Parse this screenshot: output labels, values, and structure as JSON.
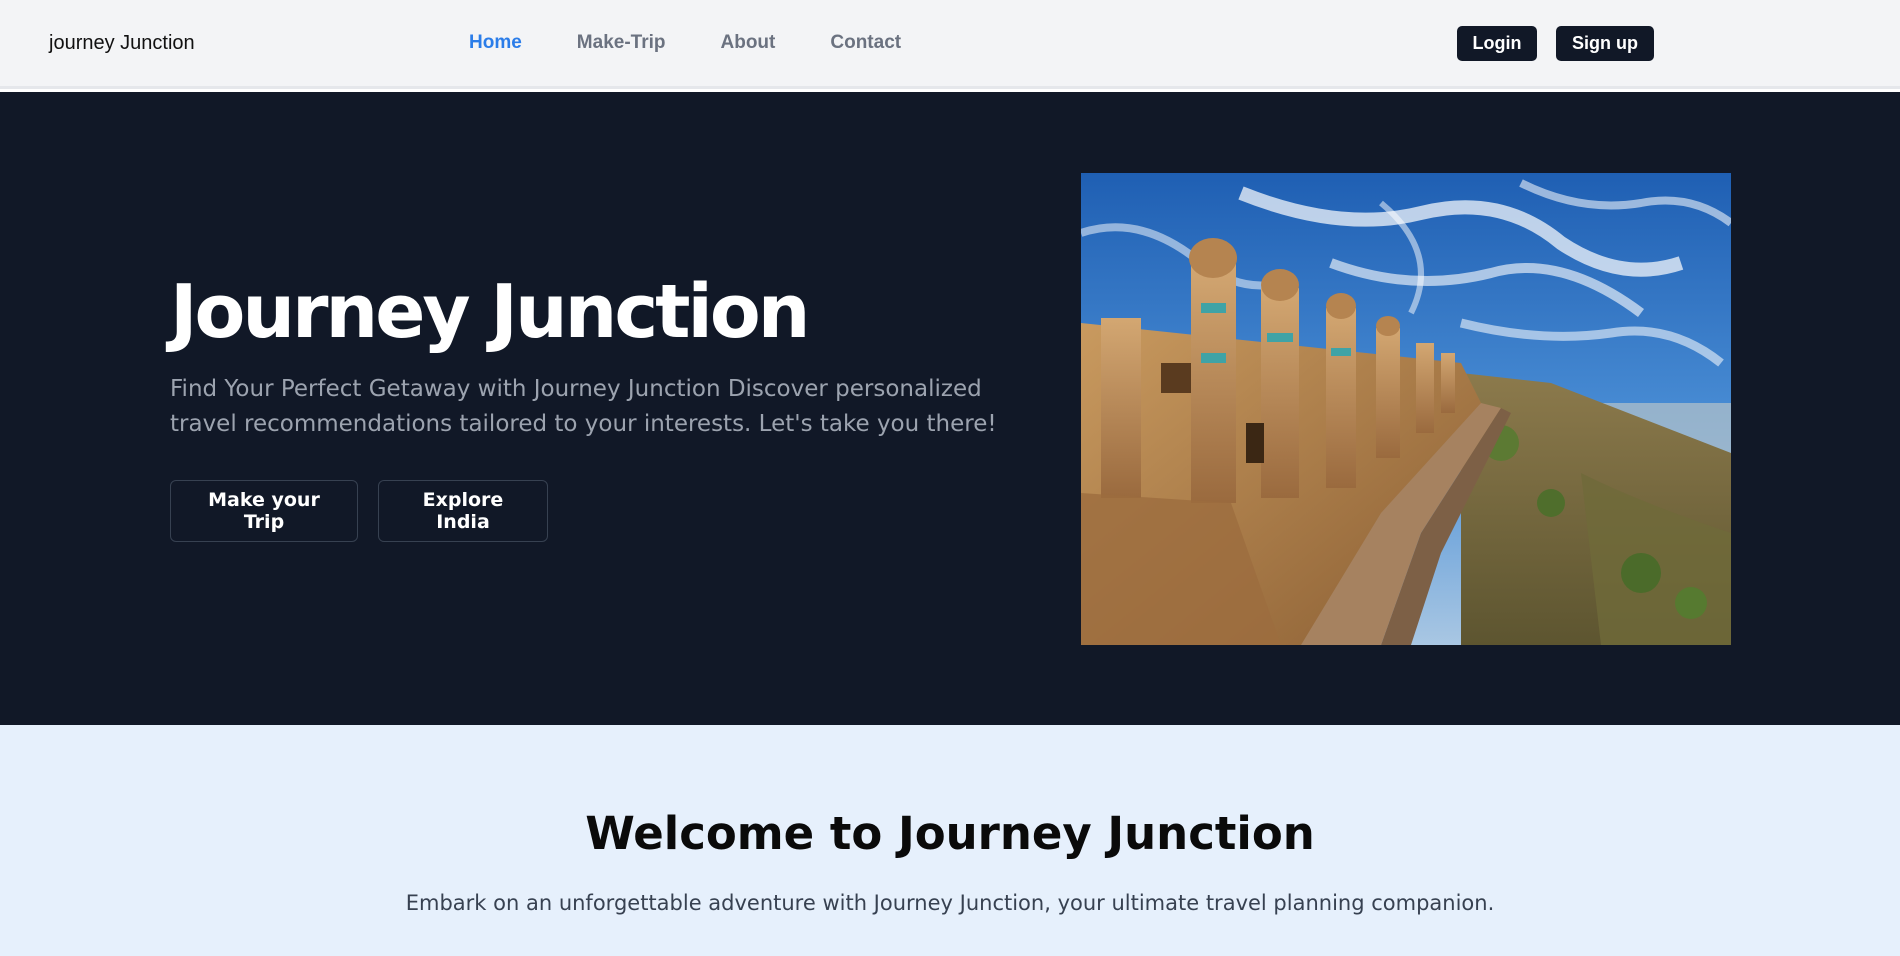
{
  "navbar": {
    "brand": "journey Junction",
    "links": [
      {
        "label": "Home",
        "active": true
      },
      {
        "label": "Make-Trip",
        "active": false
      },
      {
        "label": "About",
        "active": false
      },
      {
        "label": "Contact",
        "active": false
      }
    ],
    "login_label": "Login",
    "signup_label": "Sign up"
  },
  "hero": {
    "title": "Journey Junction",
    "subtitle": "Find Your Perfect Getaway with Journey Junction Discover personalized travel recommendations tailored to your interests. Let's take you there!",
    "make_trip_label": "Make your Trip",
    "explore_label": "Explore India",
    "image_icon": "fort-photo"
  },
  "welcome": {
    "title": "Welcome to Journey Junction",
    "text": "Embark on an unforgettable adventure with Journey Junction, your ultimate travel planning companion."
  },
  "colors": {
    "hero_bg": "#111827",
    "active_link": "#2b7de9",
    "welcome_bg": "#e6f0fc"
  }
}
